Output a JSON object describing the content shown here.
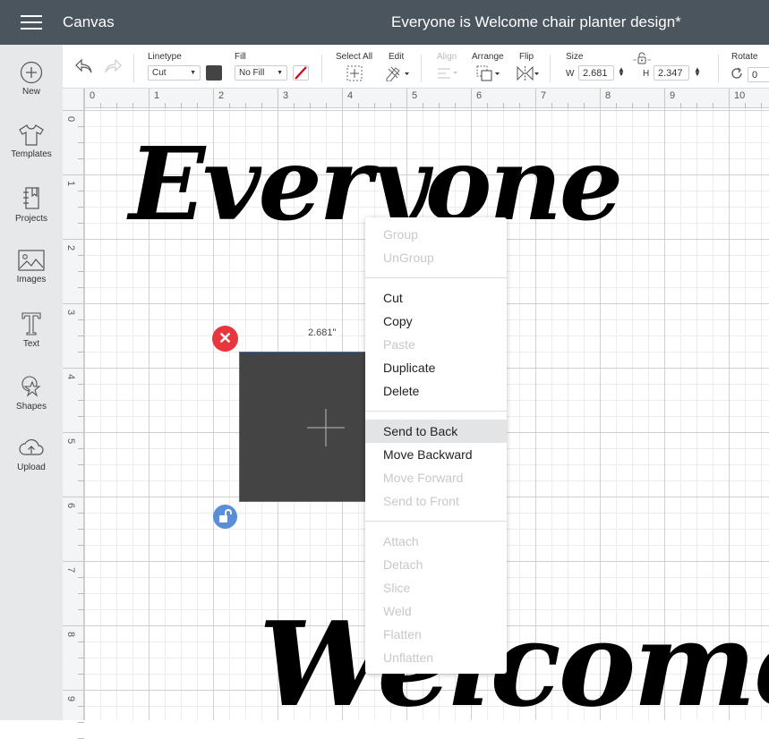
{
  "topbar": {
    "app_title": "Canvas",
    "document_title": "Everyone is Welcome chair planter design*"
  },
  "sidebar": {
    "items": [
      {
        "label": "New",
        "icon": "plus-circle-icon"
      },
      {
        "label": "Templates",
        "icon": "tshirt-icon"
      },
      {
        "label": "Projects",
        "icon": "notebook-icon"
      },
      {
        "label": "Images",
        "icon": "image-icon"
      },
      {
        "label": "Text",
        "icon": "text-t-icon"
      },
      {
        "label": "Shapes",
        "icon": "shapes-icon"
      },
      {
        "label": "Upload",
        "icon": "cloud-upload-icon"
      }
    ]
  },
  "toolbar": {
    "linetype_label": "Linetype",
    "linetype_value": "Cut",
    "linetype_color": "#444444",
    "fill_label": "Fill",
    "fill_value": "No Fill",
    "select_all_label": "Select All",
    "edit_label": "Edit",
    "align_label": "Align",
    "arrange_label": "Arrange",
    "flip_label": "Flip",
    "size_label": "Size",
    "w_label": "W",
    "w_value": "2.681",
    "h_label": "H",
    "h_value": "2.347",
    "rotate_label": "Rotate",
    "rotate_value": "0"
  },
  "rulers": {
    "horizontal": [
      "0",
      "1",
      "2",
      "3",
      "4",
      "5",
      "6",
      "7",
      "8",
      "9",
      "10"
    ],
    "vertical": [
      "0",
      "1",
      "2",
      "3",
      "4",
      "5",
      "6",
      "7",
      "8",
      "9"
    ]
  },
  "canvas": {
    "word_top": "Everyone",
    "word_bottom": "Welcome",
    "selection_width_label": "2.681\"",
    "shape_color": "#444444"
  },
  "context_menu": {
    "groups": [
      [
        {
          "label": "Group",
          "enabled": false
        },
        {
          "label": "UnGroup",
          "enabled": false
        }
      ],
      [
        {
          "label": "Cut",
          "enabled": true
        },
        {
          "label": "Copy",
          "enabled": true
        },
        {
          "label": "Paste",
          "enabled": false
        },
        {
          "label": "Duplicate",
          "enabled": true
        },
        {
          "label": "Delete",
          "enabled": true
        }
      ],
      [
        {
          "label": "Send to Back",
          "enabled": true,
          "highlighted": true
        },
        {
          "label": "Move Backward",
          "enabled": true
        },
        {
          "label": "Move Forward",
          "enabled": false
        },
        {
          "label": "Send to Front",
          "enabled": false
        }
      ],
      [
        {
          "label": "Attach",
          "enabled": false
        },
        {
          "label": "Detach",
          "enabled": false
        },
        {
          "label": "Slice",
          "enabled": false
        },
        {
          "label": "Weld",
          "enabled": false
        },
        {
          "label": "Flatten",
          "enabled": false
        },
        {
          "label": "Unflatten",
          "enabled": false
        }
      ]
    ]
  }
}
